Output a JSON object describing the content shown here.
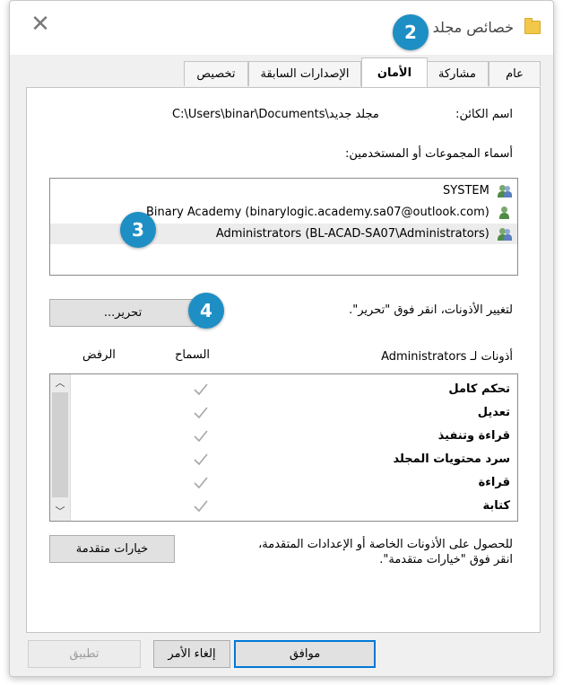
{
  "window": {
    "title": "خصائص مجلد"
  },
  "tabs": [
    {
      "label": "عام"
    },
    {
      "label": "مشاركة"
    },
    {
      "label": "الأمان"
    },
    {
      "label": "الإصدارات السابقة"
    },
    {
      "label": "تخصيص"
    }
  ],
  "object_name": {
    "label": "اسم الكائن:",
    "value": "C:\\Users\\binar\\Documents\\مجلد جديد"
  },
  "groups": {
    "label": "أسماء المجموعات أو المستخدمين:",
    "items": [
      {
        "name": "SYSTEM"
      },
      {
        "name": "Binary Academy (binarylogic.academy.sa07@outlook.com)"
      },
      {
        "name": "Administrators (BL-ACAD-SA07\\Administrators)"
      }
    ]
  },
  "edit": {
    "hint": "لتغيير الأذونات، انقر فوق \"تحرير\".",
    "button": "تحرير..."
  },
  "permissions": {
    "label": "أذونات لـ Administrators",
    "allow_header": "السماح",
    "deny_header": "الرفض",
    "rows": [
      {
        "name": "تحكم كامل",
        "allow": true
      },
      {
        "name": "تعديل",
        "allow": true
      },
      {
        "name": "قراءة وتنفيذ",
        "allow": true
      },
      {
        "name": "سرد محتويات المجلد",
        "allow": true
      },
      {
        "name": "قراءة",
        "allow": true
      },
      {
        "name": "كتابة",
        "allow": true
      }
    ]
  },
  "advanced": {
    "hint": "للحصول على الأذونات الخاصة أو الإعدادات المتقدمة، انقر فوق \"خيارات متقدمة\".",
    "button": "خيارات متقدمة"
  },
  "footer": {
    "ok": "موافق",
    "cancel": "إلغاء الأمر",
    "apply": "تطبيق"
  },
  "callouts": [
    "2",
    "3",
    "4"
  ],
  "colors": {
    "callout": "#1e8fc4",
    "default_button_border": "#0078d7"
  }
}
